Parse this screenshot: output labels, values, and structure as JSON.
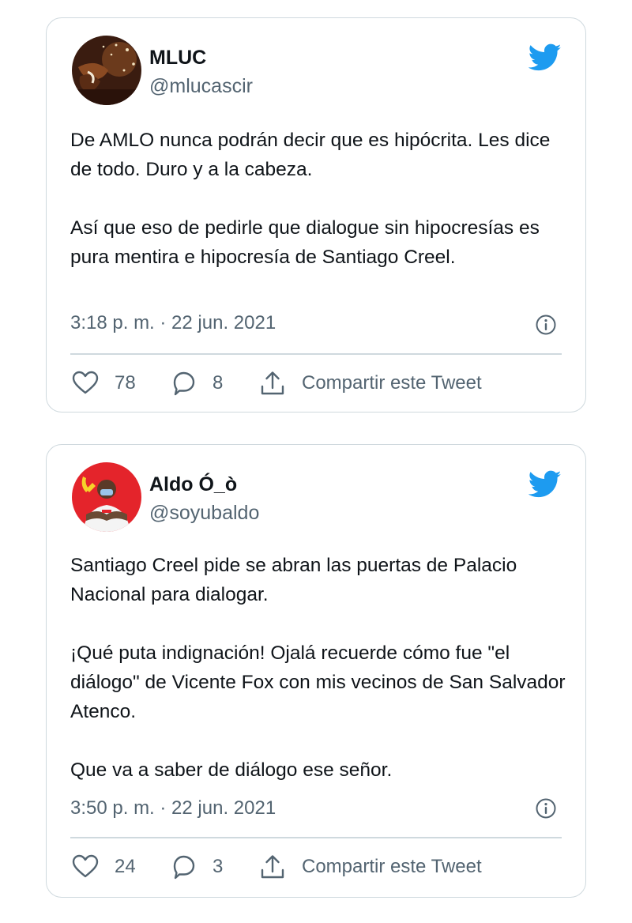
{
  "tweets": [
    {
      "display_name": "MLUC",
      "handle": "@mlucascir",
      "text": "De AMLO nunca podrán decir que es hipócrita. Les dice de todo. Duro y a la cabeza.\n\nAsí que eso de pedirle que dialogue sin hipocresías es pura mentira e hipocresía de Santiago Creel.",
      "timestamp": "3:18 p. m. · 22 jun. 2021",
      "likes": "78",
      "replies": "8",
      "share_label": "Compartir este Tweet"
    },
    {
      "display_name": "Aldo Ó_ò",
      "handle": "@soyubaldo",
      "text": "Santiago Creel pide se abran las puertas de Palacio Nacional para dialogar.\n\n¡Qué puta indignación! Ojalá recuerde cómo fue \"el diálogo\" de Vicente Fox con mis vecinos de San Salvador Atenco.\n\nQue va a saber de diálogo ese señor.",
      "timestamp": "3:50 p. m. · 22 jun. 2021",
      "likes": "24",
      "replies": "3",
      "share_label": "Compartir este Tweet"
    }
  ],
  "colors": {
    "brand": "#1d9bf0",
    "text_primary": "#0f1419",
    "text_secondary": "#536471",
    "border": "#cfd9de"
  },
  "icons": [
    "twitter-bird-icon",
    "info-icon",
    "heart-icon",
    "reply-icon",
    "share-icon"
  ]
}
